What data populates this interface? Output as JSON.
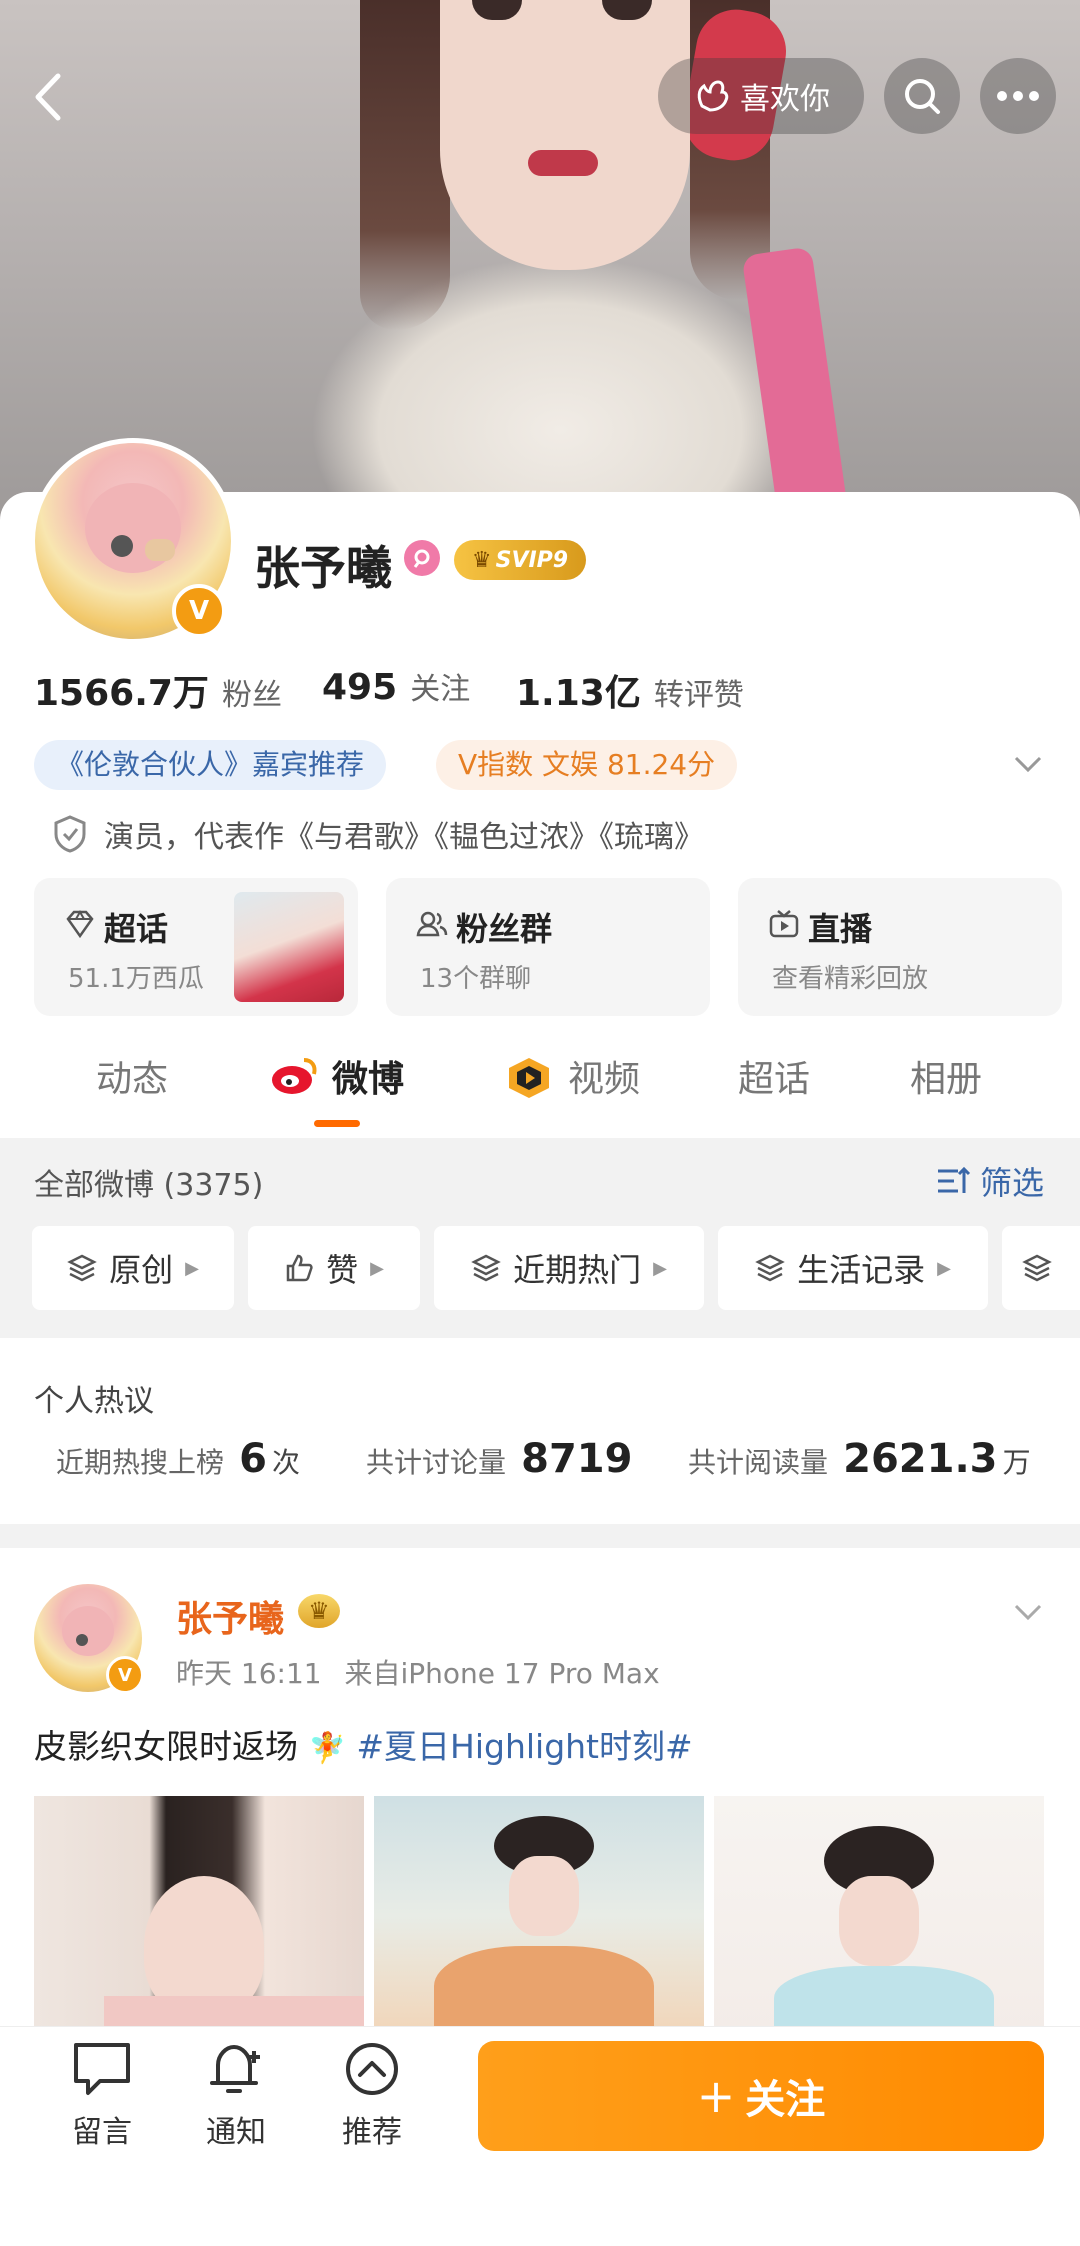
{
  "header": {
    "like_label": "喜欢你"
  },
  "profile": {
    "name": "张予曦",
    "membership": "SVIP9",
    "stats": [
      {
        "value": "1566.7万",
        "label": "粉丝"
      },
      {
        "value": "495",
        "label": "关注"
      },
      {
        "value": "1.13亿",
        "label": "转评赞"
      }
    ],
    "tags": {
      "guest_tag": "《伦敦合伙人》嘉宾推荐",
      "v_index": "V指数 文娱 81.24分"
    },
    "verified_info": "演员，代表作《与君歌》《韫色过浓》《琉璃》"
  },
  "features": [
    {
      "title": "超话",
      "subtitle": "51.1万西瓜",
      "icon": "diamond-icon"
    },
    {
      "title": "粉丝群",
      "subtitle": "13个群聊",
      "icon": "group-icon"
    },
    {
      "title": "直播",
      "subtitle": "查看精彩回放",
      "icon": "tv-icon"
    }
  ],
  "tabs": [
    "动态",
    "微博",
    "视频",
    "超话",
    "相册"
  ],
  "active_tab": "微博",
  "filter": {
    "all_label": "全部微博 (3375)",
    "filter_label": "筛选",
    "chips": [
      "原创",
      "赞",
      "近期热门",
      "生活记录"
    ]
  },
  "hot_discussion": {
    "title": "个人热议",
    "items": [
      {
        "label": "近期热搜上榜",
        "value": "6",
        "unit": "次"
      },
      {
        "label": "共计讨论量",
        "value": "8719",
        "unit": ""
      },
      {
        "label": "共计阅读量",
        "value": "2621.3",
        "unit": "万"
      }
    ]
  },
  "post": {
    "author": "张予曦",
    "time": "昨天 16:11",
    "source": "来自iPhone 17 Pro Max",
    "text": "皮影织女限时返场",
    "hashtag": "#夏日Highlight时刻#"
  },
  "bottom_bar": {
    "items": [
      {
        "label": "留言",
        "icon": "message-icon"
      },
      {
        "label": "通知",
        "icon": "bell-icon"
      },
      {
        "label": "推荐",
        "icon": "recommend-icon"
      }
    ],
    "follow_label": "关注"
  },
  "colors": {
    "accent": "#ff8a00",
    "link": "#3a67a8",
    "active_underline": "#ff6a00"
  }
}
